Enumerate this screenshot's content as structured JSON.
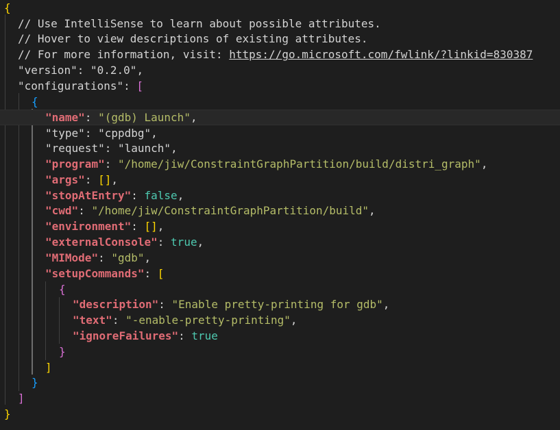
{
  "comments": [
    "// Use IntelliSense to learn about possible attributes.",
    "// Hover to view descriptions of existing attributes.",
    "// For more information, visit: "
  ],
  "comment_link": "https://go.microsoft.com/fwlink/?linkid=830387",
  "version": {
    "key": "version",
    "value": "0.2.0"
  },
  "configurations_key": "configurations",
  "config": {
    "name": {
      "key": "name",
      "value": "(gdb) Launch"
    },
    "type": {
      "key": "type",
      "value": "cppdbg"
    },
    "request": {
      "key": "request",
      "value": "launch"
    },
    "program": {
      "key": "program",
      "value": "/home/jiw/ConstraintGraphPartition/build/distri_graph"
    },
    "args": {
      "key": "args",
      "value": "[]"
    },
    "stopAtEntry": {
      "key": "stopAtEntry",
      "value": "false"
    },
    "cwd": {
      "key": "cwd",
      "value": "/home/jiw/ConstraintGraphPartition/build"
    },
    "environment": {
      "key": "environment",
      "value": "[]"
    },
    "externalConsole": {
      "key": "externalConsole",
      "value": "true"
    },
    "MIMode": {
      "key": "MIMode",
      "value": "gdb"
    },
    "setupCommands_key": "setupCommands",
    "setup": {
      "description": {
        "key": "description",
        "value": "Enable pretty-printing for gdb"
      },
      "text": {
        "key": "text",
        "value": "-enable-pretty-printing"
      },
      "ignoreFailures": {
        "key": "ignoreFailures",
        "value": "true"
      }
    }
  },
  "colors": {
    "background": "#1e1e1e",
    "key": "#e06c75",
    "string": "#b5bd68",
    "boolean": "#4ec9b0",
    "bracket_level1": "#ffd700",
    "bracket_level2": "#da70d6",
    "bracket_level3": "#179fff"
  }
}
